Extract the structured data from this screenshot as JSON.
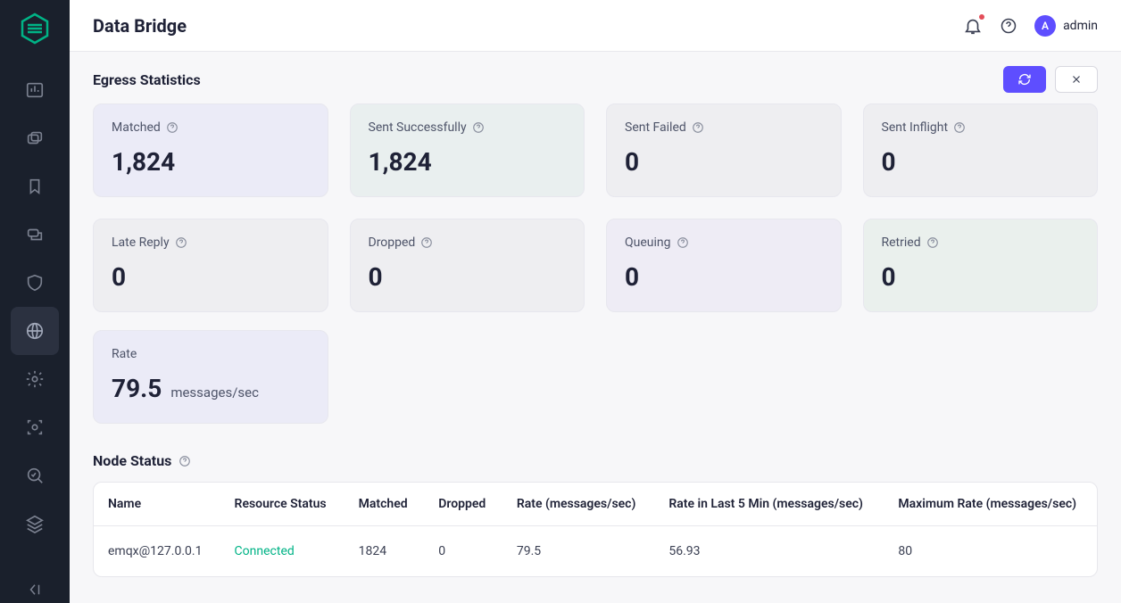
{
  "header": {
    "title": "Data Bridge",
    "username": "admin",
    "avatar_initial": "A"
  },
  "section": {
    "title": "Egress Statistics"
  },
  "stats": {
    "matched": {
      "label": "Matched",
      "value": "1,824"
    },
    "sent_success": {
      "label": "Sent Successfully",
      "value": "1,824"
    },
    "sent_failed": {
      "label": "Sent Failed",
      "value": "0"
    },
    "sent_inflight": {
      "label": "Sent Inflight",
      "value": "0"
    },
    "late_reply": {
      "label": "Late Reply",
      "value": "0"
    },
    "dropped": {
      "label": "Dropped",
      "value": "0"
    },
    "queuing": {
      "label": "Queuing",
      "value": "0"
    },
    "retried": {
      "label": "Retried",
      "value": "0"
    },
    "rate": {
      "label": "Rate",
      "value": "79.5",
      "unit": "messages/sec"
    }
  },
  "node_section": {
    "title": "Node Status",
    "columns": {
      "name": "Name",
      "resource_status": "Resource Status",
      "matched": "Matched",
      "dropped": "Dropped",
      "rate": "Rate (messages/sec)",
      "rate_5min": "Rate in Last 5 Min (messages/sec)",
      "max_rate": "Maximum Rate (messages/sec)"
    },
    "rows": [
      {
        "name": "emqx@127.0.0.1",
        "resource_status": "Connected",
        "matched": "1824",
        "dropped": "0",
        "rate": "79.5",
        "rate_5min": "56.93",
        "max_rate": "80"
      }
    ]
  }
}
